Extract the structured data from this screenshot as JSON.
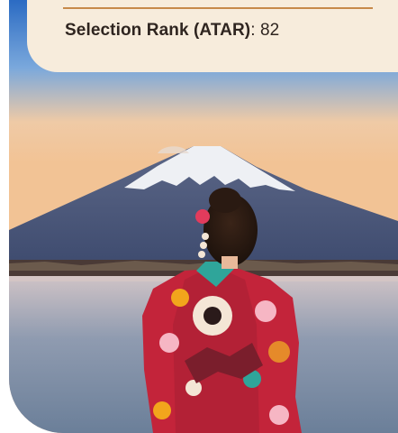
{
  "info": {
    "label": "Selection Rank (ATAR)",
    "separator": ":",
    "value": "82"
  },
  "colors": {
    "card_bg": "#f7ecdc",
    "rule": "#c78a4a",
    "text": "#2f2520"
  },
  "image": {
    "icon": "photo-mount-fuji-kimono"
  }
}
